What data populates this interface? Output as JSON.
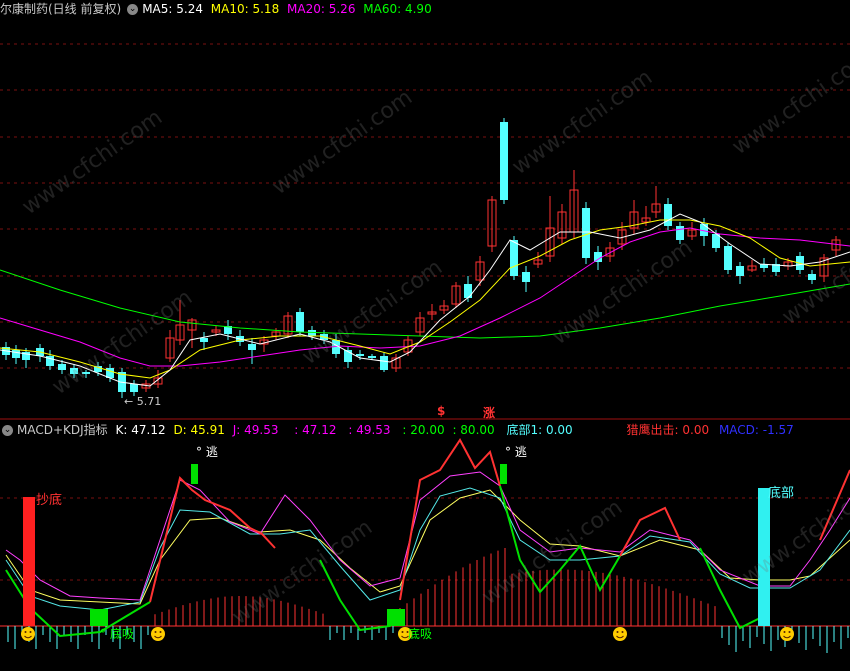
{
  "main_header": {
    "title": "尔康制药(日线 前复权)",
    "ma5": "MA5: 5.24",
    "ma10": "MA10: 5.18",
    "ma20": "MA20: 5.26",
    "ma60": "MA60: 4.90"
  },
  "sub_header": {
    "title": "MACD+KDJ指标",
    "k": "K: 47.12",
    "d": "D: 45.91",
    "j": "J: 49.53",
    "v1": ": 47.12",
    "v2": ": 49.53",
    "v3": ": 20.00",
    "v4": ": 80.00",
    "dibu1": "底部1: 0.00",
    "zhuying": "猎鹰出击: 0.00",
    "macd": "MACD: -1.57"
  },
  "annotations": {
    "low_price": "5.71",
    "dollar": "$",
    "zhang": "涨",
    "chaodi": "抄底",
    "tao1": "逃",
    "tao2": "逃",
    "dixi1": "底吸",
    "dixi2": "底吸",
    "dibu": "底部"
  },
  "watermark": "www.cfchi.com",
  "colors": {
    "up": "#ff3232",
    "down": "#54ffff",
    "ma5": "#ffffff",
    "ma10": "#ffff00",
    "ma20": "#ff00ff",
    "ma60": "#00ff00",
    "grid": "#7a1010"
  }
}
